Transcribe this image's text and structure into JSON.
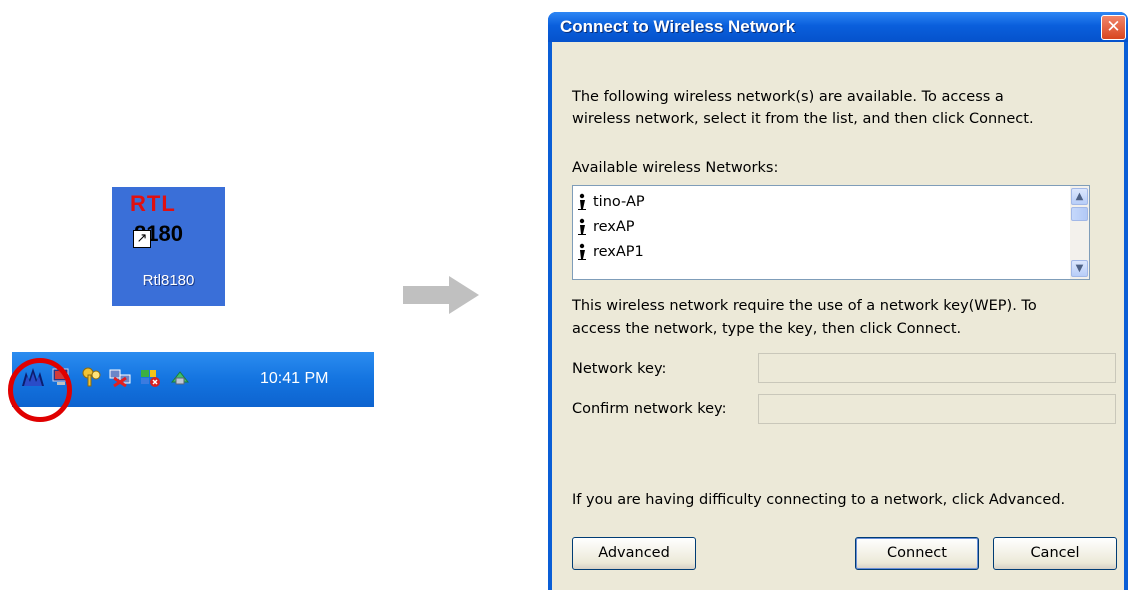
{
  "desktop": {
    "shortcut": {
      "logo_top": "RTL",
      "logo_bottom": "8180",
      "label": "Rtl8180"
    },
    "tray": {
      "time": "10:41 PM"
    }
  },
  "dialog": {
    "title": "Connect to Wireless Network",
    "close_glyph": "✕",
    "intro_line1": "The following wireless network(s) are available. To access a",
    "intro_line2": "wireless network, select it from the list, and then click Connect.",
    "available_label": "Available wireless Networks:",
    "networks": [
      {
        "name": "tino-AP"
      },
      {
        "name": "rexAP"
      },
      {
        "name": "rexAP1"
      }
    ],
    "wep_line1": "This wireless network require the use of a network key(WEP). To",
    "wep_line2": "access the network, type the key, then click Connect.",
    "network_key_label": "Network key:",
    "network_key_value": "",
    "confirm_key_label": "Confirm network key:",
    "confirm_key_value": "",
    "difficulty_text": "If you are having difficulty connecting to a network, click Advanced.",
    "buttons": {
      "advanced": "Advanced",
      "connect": "Connect",
      "cancel": "Cancel"
    }
  },
  "colors": {
    "xp_title_blue": "#0a5fdc",
    "dialog_face": "#ece9d8",
    "highlight_red": "#e00000"
  }
}
